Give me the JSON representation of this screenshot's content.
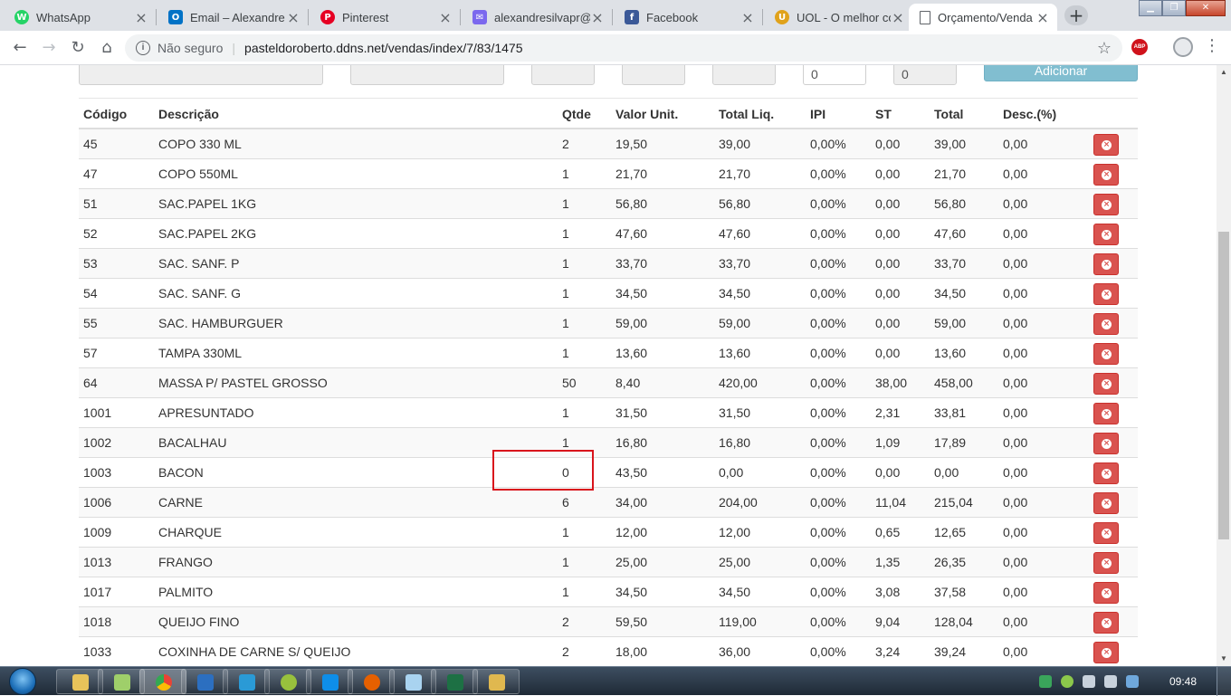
{
  "browser": {
    "tabs": [
      {
        "title": "WhatsApp",
        "favicon": "whatsapp-icon",
        "color": "#25d366",
        "glyph": "W"
      },
      {
        "title": "Email – Alexandre",
        "favicon": "outlook-icon",
        "color": "#0072c6",
        "glyph": "O"
      },
      {
        "title": "Pinterest",
        "favicon": "pinterest-icon",
        "color": "#e60023",
        "glyph": "P"
      },
      {
        "title": "alexandresilvapr@",
        "favicon": "mail-icon",
        "color": "#7b68ee",
        "glyph": "✉"
      },
      {
        "title": "Facebook",
        "favicon": "facebook-icon",
        "color": "#3b5998",
        "glyph": "f"
      },
      {
        "title": "UOL - O melhor co",
        "favicon": "uol-icon",
        "color": "#e0a21b",
        "glyph": "U"
      },
      {
        "title": "Orçamento/Venda",
        "favicon": "page-icon",
        "color": "#ffffff",
        "glyph": ""
      }
    ],
    "address": {
      "security_label": "Não seguro",
      "url": "pasteldoroberto.ddns.net/vendas/index/7/83/1475"
    },
    "abp_label": "ABP"
  },
  "form": {
    "qty_value": "0",
    "disc_value": "0",
    "add_label": "Adicionar"
  },
  "table": {
    "headers": [
      "Código",
      "Descrição",
      "Qtde",
      "Valor Unit.",
      "Total Liq.",
      "IPI",
      "ST",
      "Total",
      "Desc.(%)"
    ],
    "rows": [
      {
        "codigo": "45",
        "descricao": "COPO 330 ML",
        "qtde": "2",
        "valor_unit": "19,50",
        "total_liq": "39,00",
        "ipi": "0,00%",
        "st": "0,00",
        "total": "39,00",
        "desc": "0,00"
      },
      {
        "codigo": "47",
        "descricao": "COPO 550ML",
        "qtde": "1",
        "valor_unit": "21,70",
        "total_liq": "21,70",
        "ipi": "0,00%",
        "st": "0,00",
        "total": "21,70",
        "desc": "0,00"
      },
      {
        "codigo": "51",
        "descricao": "SAC.PAPEL 1KG",
        "qtde": "1",
        "valor_unit": "56,80",
        "total_liq": "56,80",
        "ipi": "0,00%",
        "st": "0,00",
        "total": "56,80",
        "desc": "0,00"
      },
      {
        "codigo": "52",
        "descricao": "SAC.PAPEL 2KG",
        "qtde": "1",
        "valor_unit": "47,60",
        "total_liq": "47,60",
        "ipi": "0,00%",
        "st": "0,00",
        "total": "47,60",
        "desc": "0,00"
      },
      {
        "codigo": "53",
        "descricao": "SAC. SANF. P",
        "qtde": "1",
        "valor_unit": "33,70",
        "total_liq": "33,70",
        "ipi": "0,00%",
        "st": "0,00",
        "total": "33,70",
        "desc": "0,00"
      },
      {
        "codigo": "54",
        "descricao": "SAC. SANF. G",
        "qtde": "1",
        "valor_unit": "34,50",
        "total_liq": "34,50",
        "ipi": "0,00%",
        "st": "0,00",
        "total": "34,50",
        "desc": "0,00"
      },
      {
        "codigo": "55",
        "descricao": "SAC. HAMBURGUER",
        "qtde": "1",
        "valor_unit": "59,00",
        "total_liq": "59,00",
        "ipi": "0,00%",
        "st": "0,00",
        "total": "59,00",
        "desc": "0,00"
      },
      {
        "codigo": "57",
        "descricao": "TAMPA 330ML",
        "qtde": "1",
        "valor_unit": "13,60",
        "total_liq": "13,60",
        "ipi": "0,00%",
        "st": "0,00",
        "total": "13,60",
        "desc": "0,00"
      },
      {
        "codigo": "64",
        "descricao": "MASSA P/ PASTEL GROSSO",
        "qtde": "50",
        "valor_unit": "8,40",
        "total_liq": "420,00",
        "ipi": "0,00%",
        "st": "38,00",
        "total": "458,00",
        "desc": "0,00"
      },
      {
        "codigo": "1001",
        "descricao": "APRESUNTADO",
        "qtde": "1",
        "valor_unit": "31,50",
        "total_liq": "31,50",
        "ipi": "0,00%",
        "st": "2,31",
        "total": "33,81",
        "desc": "0,00"
      },
      {
        "codigo": "1002",
        "descricao": "BACALHAU",
        "qtde": "1",
        "valor_unit": "16,80",
        "total_liq": "16,80",
        "ipi": "0,00%",
        "st": "1,09",
        "total": "17,89",
        "desc": "0,00"
      },
      {
        "codigo": "1003",
        "descricao": "BACON",
        "qtde": "0",
        "valor_unit": "43,50",
        "total_liq": "0,00",
        "ipi": "0,00%",
        "st": "0,00",
        "total": "0,00",
        "desc": "0,00"
      },
      {
        "codigo": "1006",
        "descricao": "CARNE",
        "qtde": "6",
        "valor_unit": "34,00",
        "total_liq": "204,00",
        "ipi": "0,00%",
        "st": "11,04",
        "total": "215,04",
        "desc": "0,00"
      },
      {
        "codigo": "1009",
        "descricao": "CHARQUE",
        "qtde": "1",
        "valor_unit": "12,00",
        "total_liq": "12,00",
        "ipi": "0,00%",
        "st": "0,65",
        "total": "12,65",
        "desc": "0,00"
      },
      {
        "codigo": "1013",
        "descricao": "FRANGO",
        "qtde": "1",
        "valor_unit": "25,00",
        "total_liq": "25,00",
        "ipi": "0,00%",
        "st": "1,35",
        "total": "26,35",
        "desc": "0,00"
      },
      {
        "codigo": "1017",
        "descricao": "PALMITO",
        "qtde": "1",
        "valor_unit": "34,50",
        "total_liq": "34,50",
        "ipi": "0,00%",
        "st": "3,08",
        "total": "37,58",
        "desc": "0,00"
      },
      {
        "codigo": "1018",
        "descricao": "QUEIJO FINO",
        "qtde": "2",
        "valor_unit": "59,50",
        "total_liq": "119,00",
        "ipi": "0,00%",
        "st": "9,04",
        "total": "128,04",
        "desc": "0,00"
      },
      {
        "codigo": "1033",
        "descricao": "COXINHA DE CARNE S/ QUEIJO",
        "qtde": "2",
        "valor_unit": "18,00",
        "total_liq": "36,00",
        "ipi": "0,00%",
        "st": "3,24",
        "total": "39,24",
        "desc": "0,00"
      }
    ]
  },
  "colors": {
    "delete_button": "#d9534f",
    "add_button": "#81bed0",
    "highlight_border": "#d9141c"
  },
  "taskbar": {
    "clock": "09:48",
    "apps": [
      "explorer-icon",
      "file-manager-icon",
      "chrome-icon",
      "outlook-icon",
      "skype-icon",
      "android-icon",
      "teamviewer-icon",
      "firefox-icon",
      "notepad-icon",
      "excel-icon",
      "keepass-icon"
    ]
  }
}
